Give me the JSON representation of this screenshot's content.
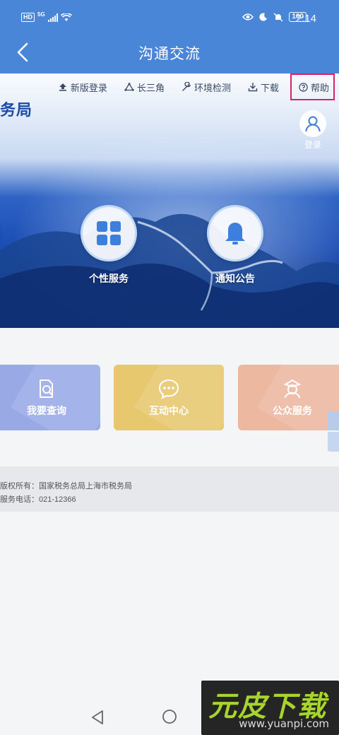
{
  "status_bar": {
    "hd": "HD",
    "network": "5G",
    "battery": "100",
    "time": "2:14"
  },
  "header": {
    "title": "沟通交流"
  },
  "toolbar": {
    "items": [
      {
        "label": "新版登录",
        "icon": "cloud-upload-icon"
      },
      {
        "label": "长三角",
        "icon": "triangle-nodes-icon"
      },
      {
        "label": "环境检测",
        "icon": "wrench-icon"
      },
      {
        "label": "下载",
        "icon": "download-icon"
      },
      {
        "label": "帮助",
        "icon": "help-circle-icon",
        "highlighted": true
      }
    ]
  },
  "banner": {
    "site_name": "务局",
    "login_label": "登录",
    "services": [
      {
        "label": "个性服务",
        "icon": "grid-icon"
      },
      {
        "label": "通知公告",
        "icon": "bell-icon"
      },
      {
        "label": "",
        "icon": "partial-circle"
      }
    ]
  },
  "cards": [
    {
      "label": "我要查询",
      "icon": "search-document-icon",
      "color": "#98a9e6"
    },
    {
      "label": "互动中心",
      "icon": "chat-bubble-icon",
      "color": "#e7c86e"
    },
    {
      "label": "公众服务",
      "icon": "officer-icon",
      "color": "#ecb8a0"
    }
  ],
  "footer": {
    "copyright": "版权所有：国家税务总局上海市税务局",
    "phone": "服务电话：021-12366"
  },
  "watermark": {
    "title": "元皮下载",
    "url": "www.yuanpi.com"
  },
  "colors": {
    "header_blue": "#4a86d8",
    "help_highlight": "#d6226f",
    "banner_blue": "#1b4db4"
  }
}
